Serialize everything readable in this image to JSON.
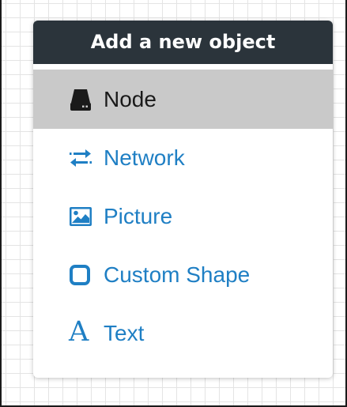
{
  "menu": {
    "title": "Add a new object",
    "items": [
      {
        "label": "Node",
        "icon": "hdd-icon",
        "active": true
      },
      {
        "label": "Network",
        "icon": "exchange-icon",
        "active": false
      },
      {
        "label": "Picture",
        "icon": "picture-icon",
        "active": false
      },
      {
        "label": "Custom Shape",
        "icon": "square-outline-icon",
        "active": false
      },
      {
        "label": "Text",
        "icon": "text-a-icon",
        "active": false
      }
    ]
  },
  "colors": {
    "header_bg": "#2b343b",
    "active_bg": "#c9c9c9",
    "link": "#1f7fc4"
  }
}
